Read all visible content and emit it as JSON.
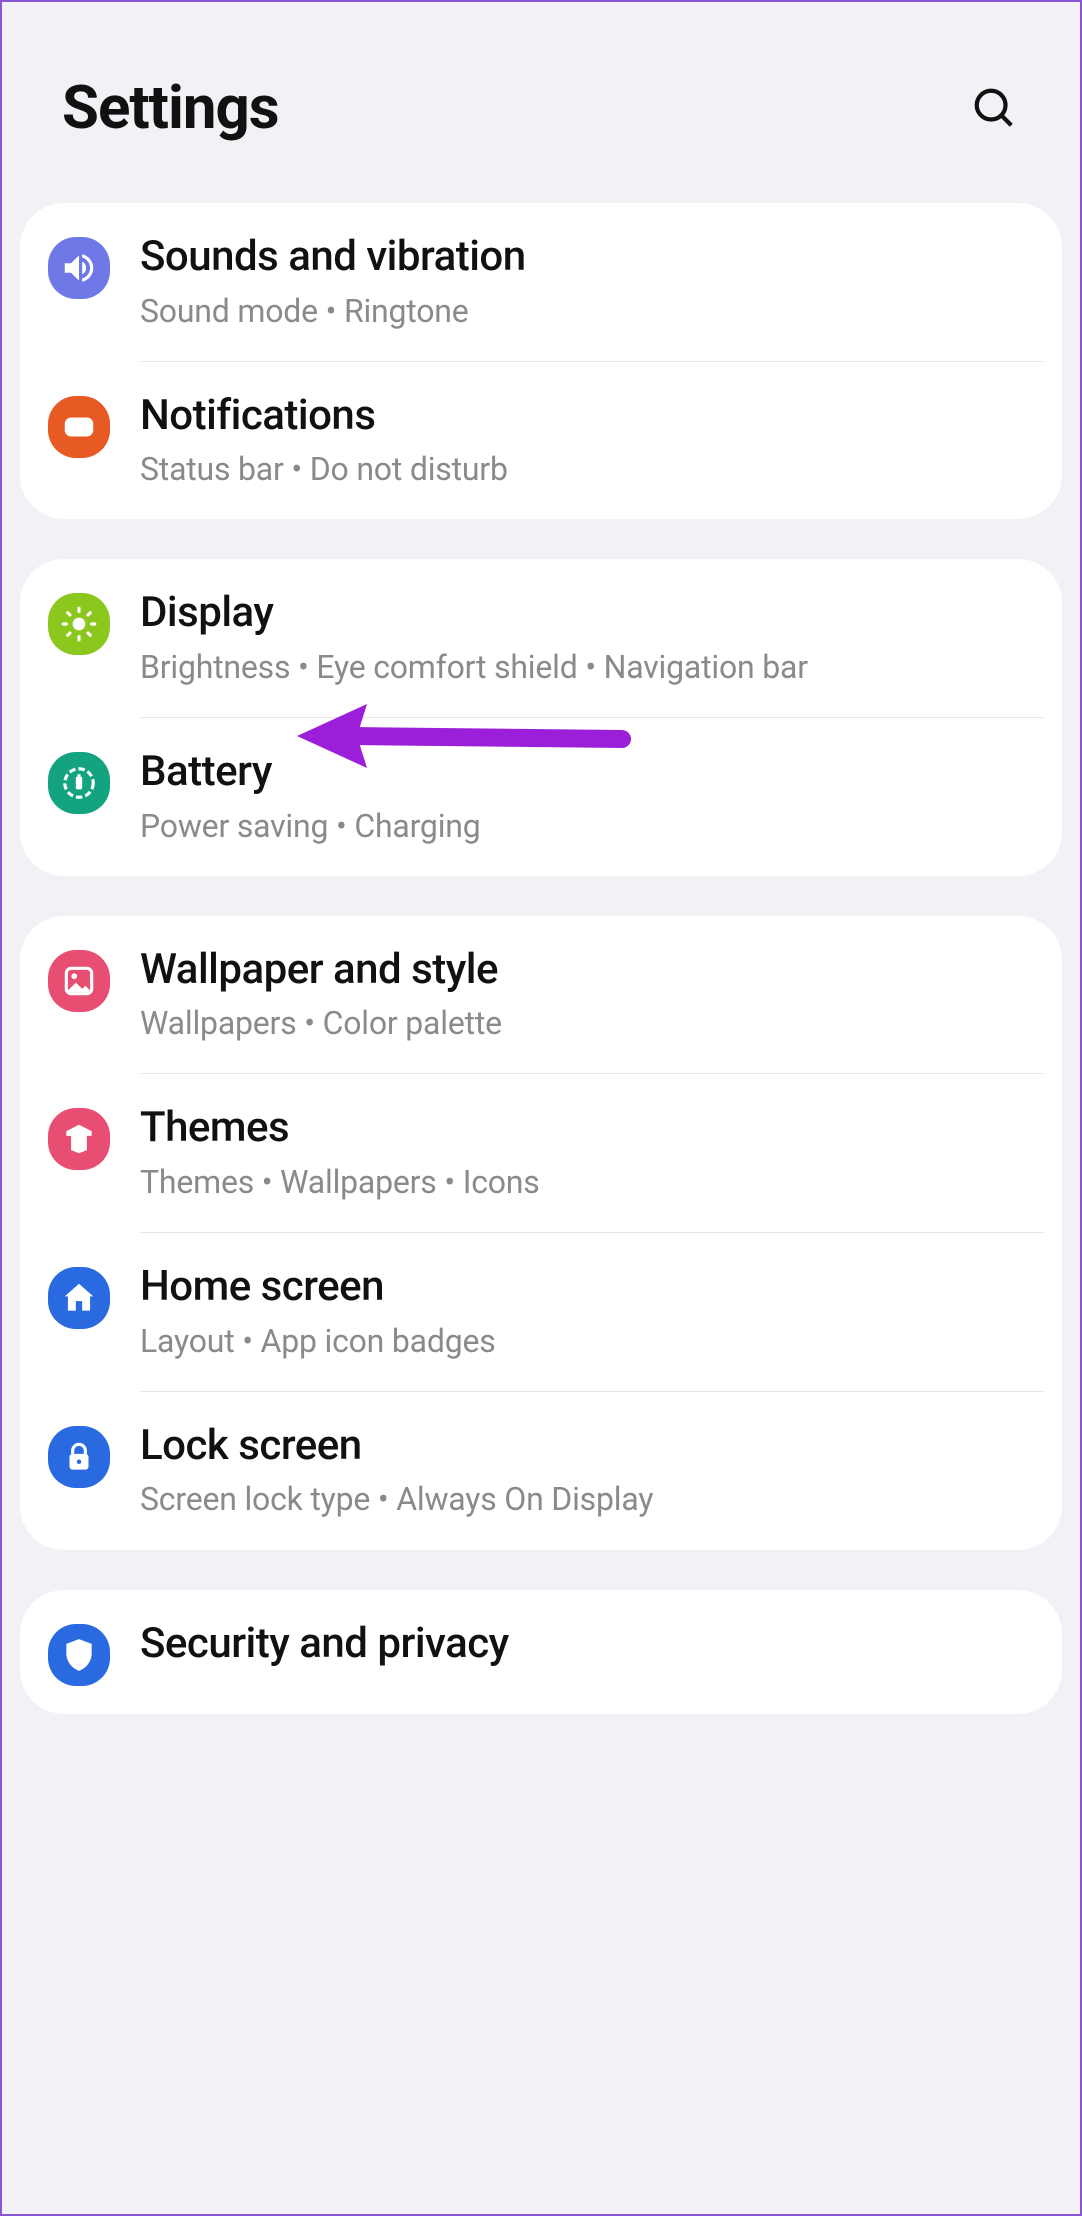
{
  "header": {
    "title": "Settings"
  },
  "groups": [
    {
      "items": [
        {
          "key": "sound",
          "title": "Sounds and vibration",
          "sub": "Sound mode  •  Ringtone",
          "icon": "sound-icon"
        },
        {
          "key": "notifications",
          "title": "Notifications",
          "sub": "Status bar  •  Do not disturb",
          "icon": "notifications-icon"
        }
      ]
    },
    {
      "items": [
        {
          "key": "display",
          "title": "Display",
          "sub": "Brightness  •  Eye comfort shield  •  Navigation bar",
          "icon": "display-icon"
        },
        {
          "key": "battery",
          "title": "Battery",
          "sub": "Power saving  •  Charging",
          "icon": "battery-icon"
        }
      ]
    },
    {
      "items": [
        {
          "key": "wallpaper",
          "title": "Wallpaper and style",
          "sub": "Wallpapers  •  Color palette",
          "icon": "wallpaper-icon"
        },
        {
          "key": "themes",
          "title": "Themes",
          "sub": "Themes  •  Wallpapers  •  Icons",
          "icon": "themes-icon"
        },
        {
          "key": "home",
          "title": "Home screen",
          "sub": "Layout  •  App icon badges",
          "icon": "home-icon"
        },
        {
          "key": "lock",
          "title": "Lock screen",
          "sub": "Screen lock type  •  Always On Display",
          "icon": "lock-icon"
        }
      ]
    },
    {
      "items": [
        {
          "key": "security",
          "title": "Security and privacy",
          "sub": "",
          "icon": "security-icon"
        }
      ]
    }
  ],
  "annotation": {
    "target": "battery",
    "color": "#9b1fd9"
  }
}
